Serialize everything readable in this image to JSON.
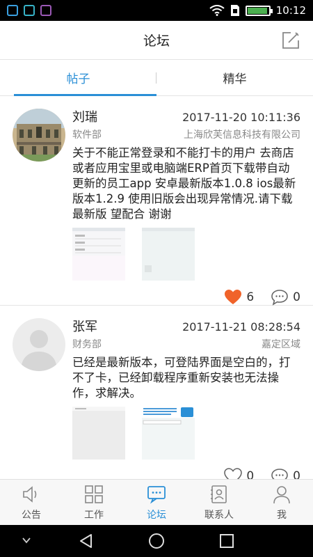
{
  "status_bar": {
    "time": "10:12",
    "icons": [
      "maps-app-icon",
      "photo-app-icon",
      "gallery-app-icon",
      "wifi-icon",
      "sim-icon",
      "battery-icon"
    ],
    "battery_level": 0.95
  },
  "header": {
    "title": "论坛",
    "action_icon": "edit-icon"
  },
  "tabs": [
    {
      "label": "帖子",
      "active": true
    },
    {
      "label": "精华",
      "active": false
    }
  ],
  "posts": [
    {
      "author": "刘瑞",
      "timestamp": "2017-11-20 10:11:36",
      "department": "软件部",
      "location": "上海欣芙信息科技有限公司",
      "content": "关于不能正常登录和不能打卡的用户 去商店或者应用宝里或电脑端ERP首页下载带自动更新的员工app 安卓最新版本1.0.8 ios最新版本1.2.9 使用旧版会出现异常情况.请下载最新版 望配合 谢谢",
      "likes": "6",
      "liked": true,
      "comments": "0"
    },
    {
      "author": "张军",
      "timestamp": "2017-11-21 08:28:54",
      "department": "财务部",
      "location": "嘉定区域",
      "content": "已经是最新版本，可登陆界面是空白的，打不了卡，已经卸载程序重新安装也无法操作，求解决。",
      "likes": "0",
      "liked": false,
      "comments": "0"
    }
  ],
  "bottom_nav": [
    {
      "label": "公告",
      "icon": "speaker-icon",
      "active": false
    },
    {
      "label": "工作",
      "icon": "grid-icon",
      "active": false
    },
    {
      "label": "论坛",
      "icon": "chat-icon",
      "active": true
    },
    {
      "label": "联系人",
      "icon": "contacts-icon",
      "active": false
    },
    {
      "label": "我",
      "icon": "person-icon",
      "active": false
    }
  ],
  "colors": {
    "accent": "#2a8fd6",
    "like": "#f0632a",
    "battery": "#4CAF50"
  }
}
